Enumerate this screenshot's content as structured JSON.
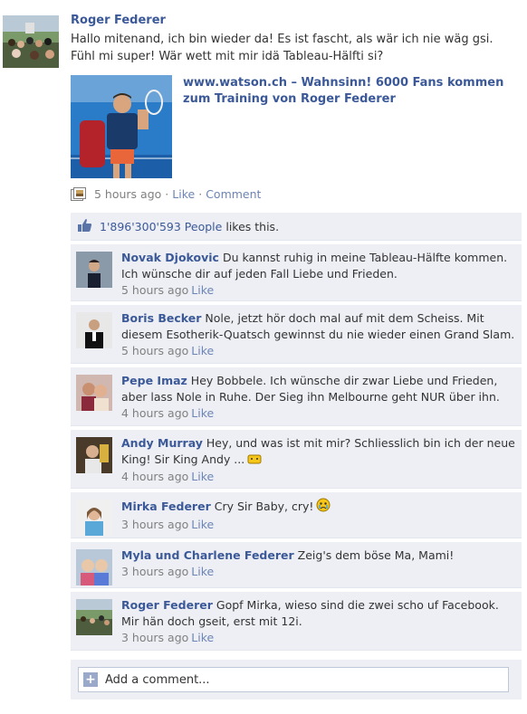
{
  "post": {
    "author": "Roger Federer",
    "text": "Hallo mitenand, ich bin wieder da! Es ist fascht, als wär ich nie wäg gsi. Fühl mi super! Wär wett mit mir idä Tableau-Hälfti si?",
    "share_title": "www.watson.ch – Wahnsinn! 6000 Fans kommen zum Training von Roger Federer",
    "time": "5 hours ago",
    "like_label": "Like",
    "comment_label": "Comment"
  },
  "likes": {
    "count": "1'896'300'593 People",
    "rest": "likes this."
  },
  "comments": [
    {
      "name": "Novak Djokovic",
      "text": "Du kannst ruhig in meine Tableau-Hälfte kommen. Ich wünsche dir auf jeden Fall Liebe und Frieden.",
      "time": "5 hours ago",
      "like": "Like"
    },
    {
      "name": "Boris Becker",
      "text": "Nole, jetzt hör doch mal auf mit dem Scheiss. Mit diesem Esotherik-Quatsch gewinnst du nie wieder einen Grand Slam.",
      "time": "5 hours ago",
      "like": "Like"
    },
    {
      "name": "Pepe Imaz",
      "text": "Hey Bobbele. Ich wünsche dir zwar Liebe und Frieden, aber lass Nole in Ruhe. Der Sieg ihn Melbourne geht NUR über ihn.",
      "time": "4 hours ago",
      "like": "Like"
    },
    {
      "name": "Andy Murray",
      "text": "Hey, und was ist mit mir? Schliesslich bin ich der neue King! Sir King Andy ...",
      "time": "4 hours ago",
      "like": "Like"
    },
    {
      "name": "Mirka Federer",
      "text": "Cry Sir Baby, cry!",
      "time": "3 hours ago",
      "like": "Like"
    },
    {
      "name": "Myla und Charlene Federer",
      "text": "Zeig's dem böse Ma, Mami!",
      "time": "3 hours ago",
      "like": "Like"
    },
    {
      "name": "Roger Federer",
      "text": "Gopf Mirka, wieso sind die zwei scho uf Facebook. Mir hän doch gseit, erst mit 12i.",
      "time": "3 hours ago",
      "like": "Like"
    }
  ],
  "add_comment": "Add a comment..."
}
